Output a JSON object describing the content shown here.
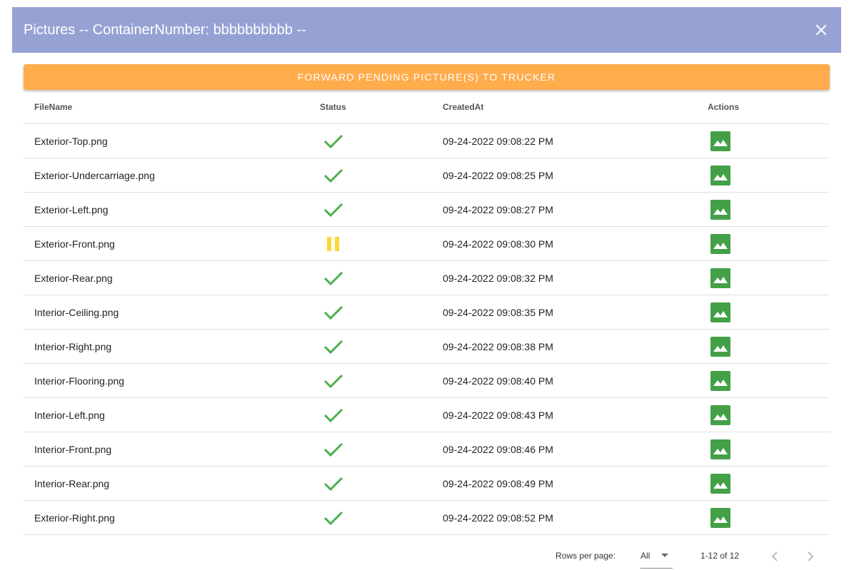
{
  "dialog": {
    "title": "Pictures -- ContainerNumber: bbbbbbbbbb --"
  },
  "actions": {
    "forward_label": "Forward Pending Picture(s) to Trucker"
  },
  "colors": {
    "header_bg": "#96a2d4",
    "forward_button": "#ffac4d",
    "status_ok": "#4caf50",
    "status_pending": "#fdd835",
    "image_icon": "#43a047"
  },
  "table": {
    "columns": [
      "FileName",
      "Status",
      "CreatedAt",
      "Actions"
    ],
    "rows": [
      {
        "file": "Exterior-Top.png",
        "status": "check-icon",
        "created": "09-24-2022 09:08:22 PM"
      },
      {
        "file": "Exterior-Undercarriage.png",
        "status": "check-icon",
        "created": "09-24-2022 09:08:25 PM"
      },
      {
        "file": "Exterior-Left.png",
        "status": "check-icon",
        "created": "09-24-2022 09:08:27 PM"
      },
      {
        "file": "Exterior-Front.png",
        "status": "pause-icon",
        "created": "09-24-2022 09:08:30 PM"
      },
      {
        "file": "Exterior-Rear.png",
        "status": "check-icon",
        "created": "09-24-2022 09:08:32 PM"
      },
      {
        "file": "Interior-Ceiling.png",
        "status": "check-icon",
        "created": "09-24-2022 09:08:35 PM"
      },
      {
        "file": "Interior-Right.png",
        "status": "check-icon",
        "created": "09-24-2022 09:08:38 PM"
      },
      {
        "file": "Interior-Flooring.png",
        "status": "check-icon",
        "created": "09-24-2022 09:08:40 PM"
      },
      {
        "file": "Interior-Left.png",
        "status": "check-icon",
        "created": "09-24-2022 09:08:43 PM"
      },
      {
        "file": "Interior-Front.png",
        "status": "check-icon",
        "created": "09-24-2022 09:08:46 PM"
      },
      {
        "file": "Interior-Rear.png",
        "status": "check-icon",
        "created": "09-24-2022 09:08:49 PM"
      },
      {
        "file": "Exterior-Right.png",
        "status": "check-icon",
        "created": "09-24-2022 09:08:52 PM"
      }
    ],
    "action_icon": "image-icon"
  },
  "pagination": {
    "rows_per_page_label": "Rows per page:",
    "rows_per_page_value": "All",
    "page_info": "1-12 of 12",
    "prev_icon": "chevron-left-icon",
    "next_icon": "chevron-right-icon"
  }
}
